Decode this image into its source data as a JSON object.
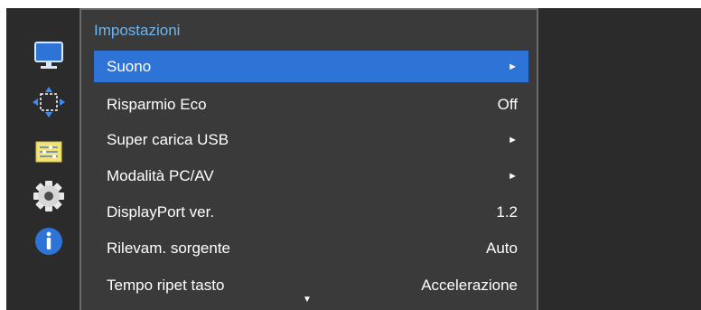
{
  "menu": {
    "title": "Impostazioni",
    "rows": [
      {
        "label": "Suono",
        "value": "►",
        "selected": true
      },
      {
        "label": "Risparmio Eco",
        "value": "Off",
        "selected": false
      },
      {
        "label": "Super carica USB",
        "value": "►",
        "selected": false
      },
      {
        "label": "Modalità PC/AV",
        "value": "►",
        "selected": false
      },
      {
        "label": "DisplayPort ver.",
        "value": "1.2",
        "selected": false
      },
      {
        "label": "Rilevam. sorgente",
        "value": "Auto",
        "selected": false
      },
      {
        "label": "Tempo ripet tasto",
        "value": "Accelerazione",
        "selected": false
      }
    ],
    "more_indicator": "▼"
  },
  "sidebar": {
    "icons": [
      "monitor-icon",
      "move-arrows-icon",
      "settings-sliders-icon",
      "gear-icon",
      "info-icon"
    ]
  },
  "colors": {
    "selected_row": "#2e74d6",
    "title_text": "#6fb4ea",
    "panel_bg": "#3a3a3a",
    "screen_bg": "#2b2b2b"
  }
}
